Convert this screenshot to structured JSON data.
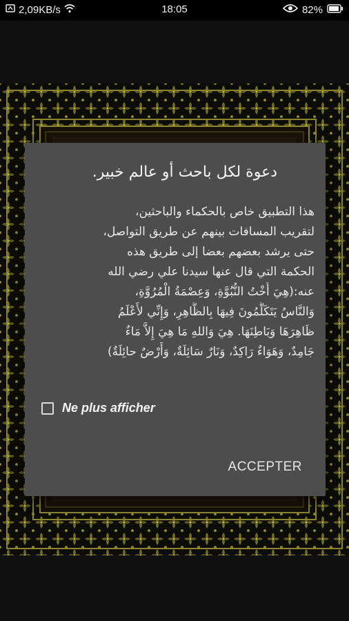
{
  "status_bar": {
    "network_speed": "2,09KB/s",
    "time": "18:05",
    "battery": "82%"
  },
  "dialog": {
    "title": "دعوة لكل باحث أو عالم خبير.",
    "body_lines": [
      "هذا التطبيق خاص بالحكماء والباحثين،",
      "لتقريب المسافات بينهم عن طريق التواصل،",
      "حتى يرشد بعضهم بعضا إلى طريق هذه",
      "الحكمة التي قال عنها سيدنا علي رضي الله",
      "عنه:(هِيَ أُخْتُ النُّبُوَّةِ، وَعِصْمَةُ الْمُرُوَّةِ،",
      "وَالنَّاسُ يَتَكَلَّمُونَ فِيهَا بِالظَّاهِرِ، وَإِنِّي لأَعْلَمُ",
      "ظَاهِرَهَا وَبَاطِنَهَا. هِيَ وَاللهِ مَا هِيَ إِلاَّ مَاءٌ",
      "جَامِدٌ، وَهَوَاءٌ رَاكِدٌ، وَنَارٌ سَائِلَةٌ، وَأَرْضٌ حائِلَةٌ)"
    ],
    "checkbox_label": "Ne plus afficher",
    "checkbox_checked": false,
    "accept_label": "ACCEPTER"
  },
  "colors": {
    "dialog_bg": "#4d4d4d",
    "ornament_gold": "#8a8632",
    "background": "#111111"
  }
}
